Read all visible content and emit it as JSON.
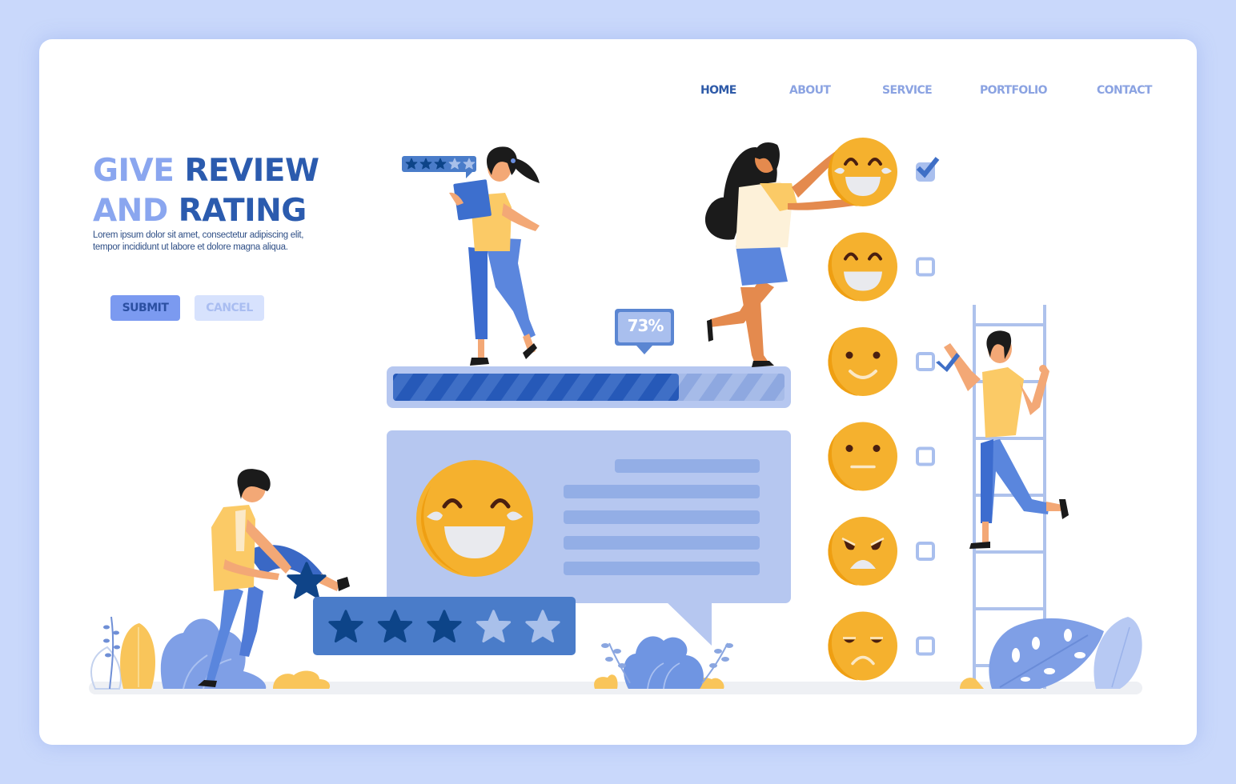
{
  "nav": {
    "items": [
      {
        "label": "HOME",
        "active": true
      },
      {
        "label": "ABOUT",
        "active": false
      },
      {
        "label": "SERVICE",
        "active": false
      },
      {
        "label": "PORTFOLIO",
        "active": false
      },
      {
        "label": "CONTACT",
        "active": false
      }
    ]
  },
  "hero": {
    "title_line1_light": "GIVE",
    "title_line1_dark": "REVIEW",
    "title_line2_light": "AND",
    "title_line2_dark": "RATING",
    "description_line1": "Lorem ipsum dolor sit amet, consectetur adipiscing elit,",
    "description_line2": "tempor incididunt ut labore et dolore magna aliqua."
  },
  "buttons": {
    "submit": "SUBMIT",
    "cancel": "CANCEL"
  },
  "progress": {
    "label": "73%",
    "value": 0.73
  },
  "star_rating": {
    "filled": 3,
    "total": 5
  },
  "mini_star_rating": {
    "filled": 3,
    "total": 5
  },
  "emoji_scale": [
    {
      "face": "tears-of-joy",
      "checked": true
    },
    {
      "face": "grinning",
      "checked": false
    },
    {
      "face": "smiling",
      "checked": false
    },
    {
      "face": "neutral",
      "checked": false
    },
    {
      "face": "angry",
      "checked": false
    },
    {
      "face": "sad",
      "checked": false
    }
  ],
  "colors": {
    "background": "#c9d8fb",
    "primary_dark": "#2b5bae",
    "primary_light": "#8aa6ef",
    "emoji_yellow": "#f5b12e",
    "star_filled": "#0d4488",
    "star_empty": "#a9c0ea",
    "rating_box": "#4a7cc9",
    "bubble": "#b6c7f0",
    "shirt_yellow": "#fbca66"
  }
}
